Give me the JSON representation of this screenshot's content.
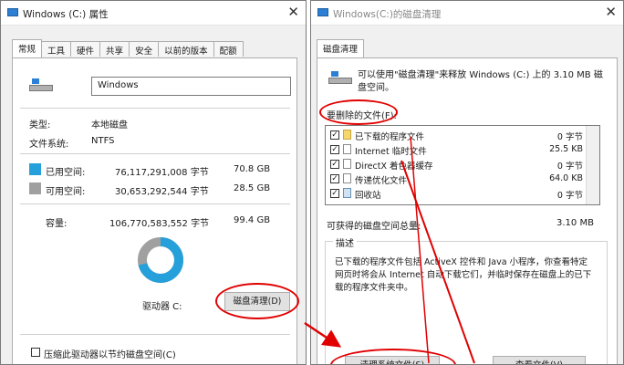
{
  "left_window": {
    "title": "Windows (C:) 属性",
    "close_glyph": "✕",
    "tabs": [
      "常规",
      "工具",
      "硬件",
      "共享",
      "安全",
      "以前的版本",
      "配额"
    ],
    "drive_name_value": "Windows",
    "type_label": "类型:",
    "type_value": "本地磁盘",
    "fs_label": "文件系统:",
    "fs_value": "NTFS",
    "used": {
      "label": "已用空间:",
      "bytes": "76,117,291,008 字节",
      "size": "70.8 GB",
      "color": "#26a0da"
    },
    "free": {
      "label": "可用空间:",
      "bytes": "30,653,292,544 字节",
      "size": "28.5 GB",
      "color": "#a0a0a0"
    },
    "capacity": {
      "label": "容量:",
      "bytes": "106,770,583,552 字节",
      "size": "99.4 GB"
    },
    "usage_fraction": 0.713,
    "drive_label": "驱动器 C:",
    "cleanup_button": "磁盘清理(D)",
    "compress_label": "压缩此驱动器以节约磁盘空间(C)"
  },
  "right_window": {
    "title": "Windows(C:)的磁盘清理",
    "close_glyph": "✕",
    "tab": "磁盘清理",
    "intro": "可以使用\"磁盘清理\"来释放 Windows (C:) 上的 3.10 MB 磁盘空间。",
    "files_label": "要删除的文件(F):",
    "files": [
      {
        "checked": true,
        "name": "已下载的程序文件",
        "size": "0 字节"
      },
      {
        "checked": true,
        "name": "Internet 临时文件",
        "size": "25.5 KB"
      },
      {
        "checked": true,
        "name": "DirectX 着色器缓存",
        "size": "0 字节"
      },
      {
        "checked": true,
        "name": "传递优化文件",
        "size": "64.0 KB"
      },
      {
        "checked": true,
        "name": "回收站",
        "size": "0 字节"
      }
    ],
    "gain_label": "可获得的磁盘空间总量:",
    "gain_value": "3.10 MB",
    "desc_title": "描述",
    "desc_text": "已下载的程序文件包括 ActiveX 控件和 Java 小程序，你查看特定网页时将会从 Internet 自动下载它们，并临时保存在磁盘上的已下载的程序文件夹中。",
    "clean_sys_button": "清理系统文件(S)",
    "view_files_button": "查看文件(V)"
  },
  "colors": {
    "annotation_red": "#e00000",
    "accent_blue": "#2b7fd5"
  }
}
